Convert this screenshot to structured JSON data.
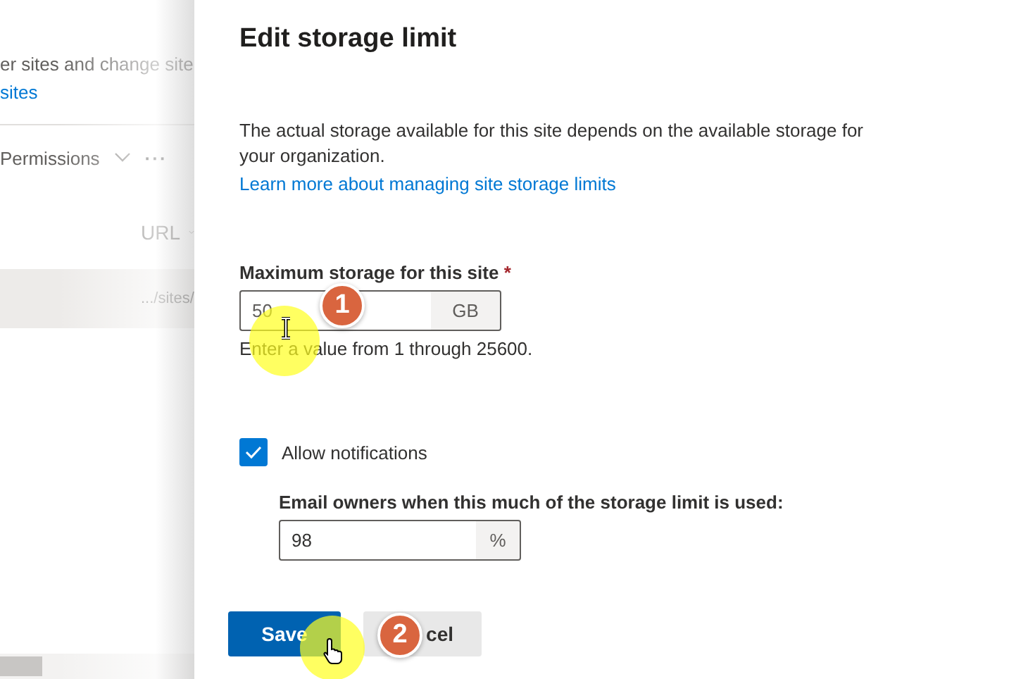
{
  "background_page": {
    "description": "er sites and change site",
    "link": "sites",
    "command": "Permissions",
    "more": "···",
    "column_header": "URL",
    "row_cell": ".../sites/"
  },
  "panel": {
    "title": "Edit storage limit",
    "description": "The actual storage available for this site depends on the available storage for your organization.",
    "learn_more_link": "Learn more about managing site storage limits",
    "max_storage": {
      "label": "Maximum storage for this site",
      "required_mark": "*",
      "value": "50",
      "suffix": "GB",
      "hint": "Enter a value from 1 through 25600."
    },
    "allow_notifications": {
      "label": "Allow notifications",
      "checked": true
    },
    "email_threshold": {
      "label": "Email owners when this much of the storage limit is used:",
      "value": "98",
      "suffix": "%"
    },
    "buttons": [
      {
        "label": "Save",
        "kind": "primary"
      },
      {
        "label": "cel",
        "kind": "secondary"
      }
    ]
  },
  "annotations": [
    {
      "label": "1",
      "kind": "text"
    },
    {
      "label": "2",
      "kind": "hand"
    }
  ]
}
